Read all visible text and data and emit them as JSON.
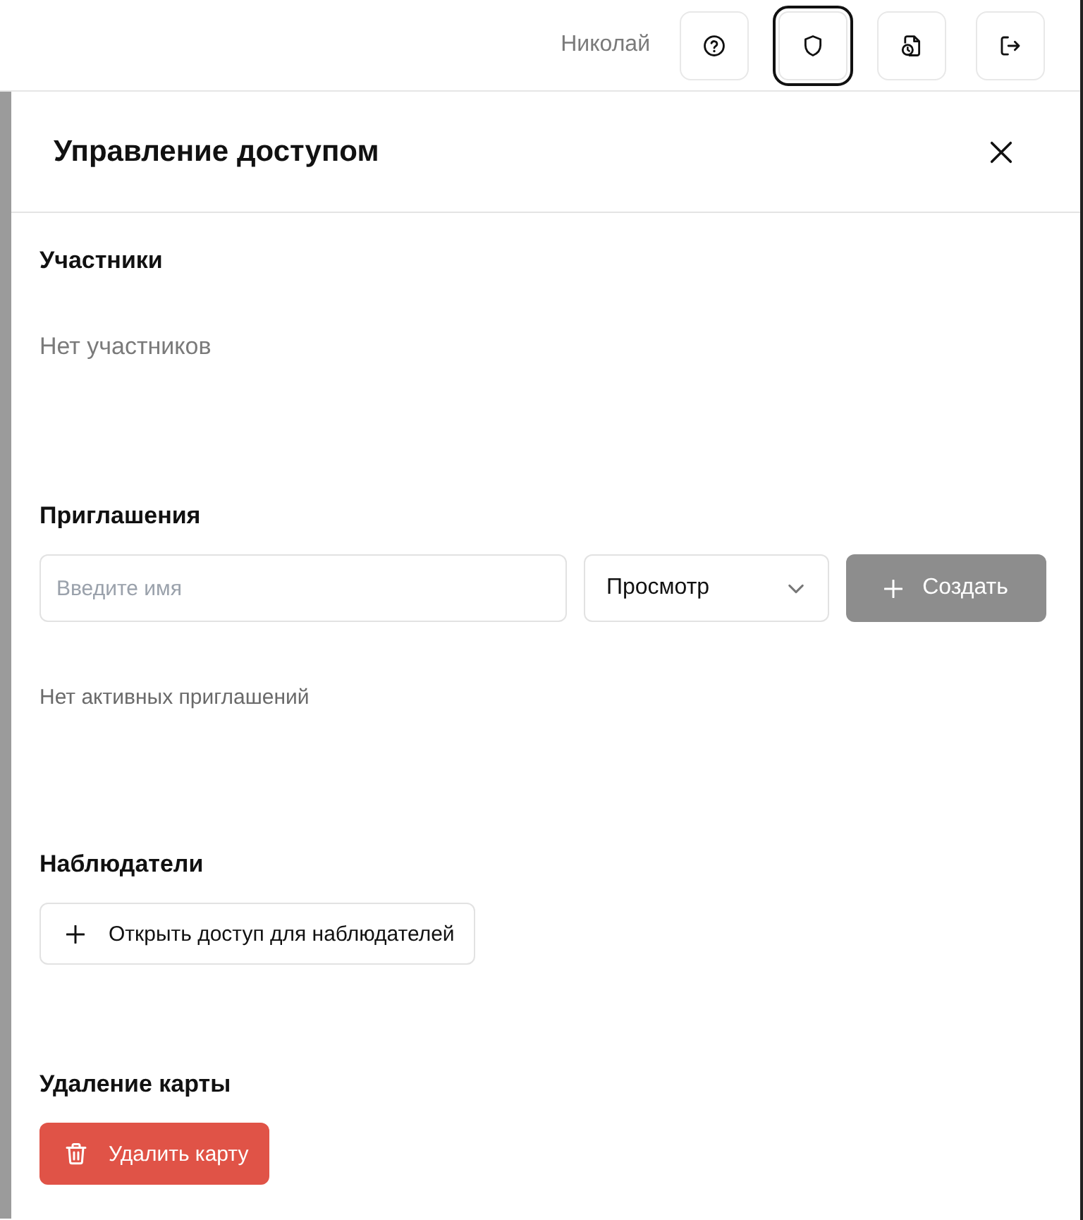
{
  "topbar": {
    "user": "Николай",
    "buttons": [
      {
        "kind": "help",
        "selected": false
      },
      {
        "kind": "shield",
        "selected": true
      },
      {
        "kind": "file-clock",
        "selected": false
      },
      {
        "kind": "logout",
        "selected": false
      }
    ]
  },
  "panel": {
    "title": "Управление доступом",
    "members": {
      "heading": "Участники",
      "empty_text": "Нет участников"
    },
    "invitations": {
      "heading": "Приглашения",
      "name_field": {
        "placeholder": "Введите имя"
      },
      "role_select": {
        "value": "Просмотр"
      },
      "create_button": {
        "label": "Создать",
        "disabled": true
      },
      "empty_text": "Нет активных приглашений"
    },
    "observers": {
      "heading": "Наблюдатели",
      "button": {
        "label": "Открыть доступ для наблюдателей"
      }
    },
    "delete": {
      "heading": "Удаление карты",
      "button": {
        "label": "Удалить карту"
      }
    }
  }
}
